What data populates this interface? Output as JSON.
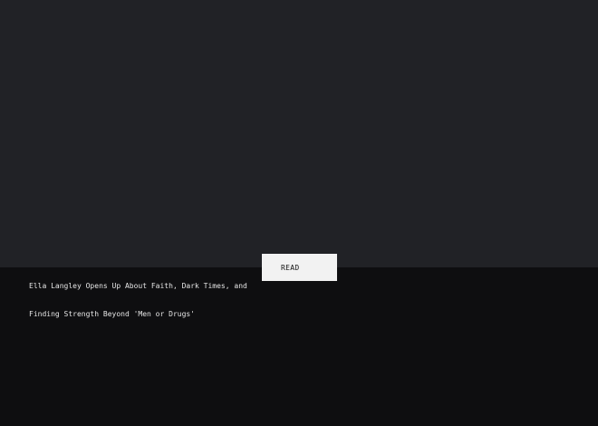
{
  "colors": {
    "hero_background": "#212226",
    "caption_background": "#0e0e10",
    "button_background": "#f2f2f2",
    "button_text": "#111111",
    "headline_text": "#e6e6e6"
  },
  "card": {
    "read_button_label": "READ",
    "headline_lines": [
      "Ella Langley Opens Up About Faith, Dark Times, and",
      "Finding Strength Beyond 'Men or Drugs'"
    ]
  }
}
